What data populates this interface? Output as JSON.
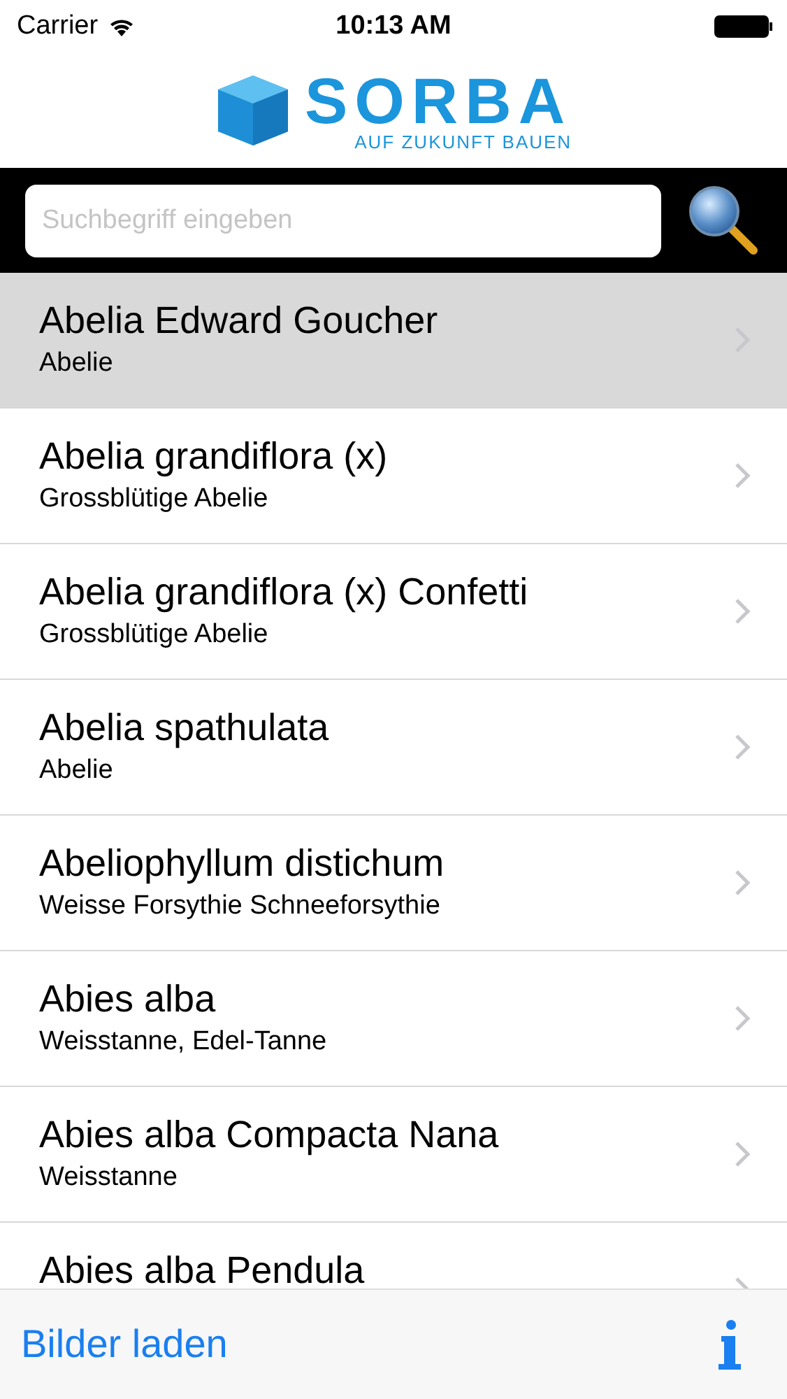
{
  "status_bar": {
    "carrier": "Carrier",
    "time": "10:13 AM"
  },
  "logo": {
    "name": "SORBA",
    "tagline": "AUF ZUKUNFT BAUEN"
  },
  "search": {
    "placeholder": "Suchbegriff eingeben"
  },
  "rows": [
    {
      "title": "Abelia  Edward Goucher",
      "subtitle": "Abelie",
      "selected": true
    },
    {
      "title": "Abelia grandiflora (x)",
      "subtitle": "Grossblütige Abelie",
      "selected": false
    },
    {
      "title": "Abelia grandiflora (x) Confetti",
      "subtitle": "Grossblütige Abelie",
      "selected": false
    },
    {
      "title": "Abelia spathulata",
      "subtitle": "Abelie",
      "selected": false
    },
    {
      "title": "Abeliophyllum distichum",
      "subtitle": "Weisse Forsythie Schneeforsythie",
      "selected": false
    },
    {
      "title": "Abies alba",
      "subtitle": "Weisstanne, Edel-Tanne",
      "selected": false
    },
    {
      "title": "Abies alba Compacta Nana",
      "subtitle": "Weisstanne",
      "selected": false
    },
    {
      "title": "Abies alba Pendula",
      "selected": false
    }
  ],
  "toolbar": {
    "load_button": "Bilder laden"
  }
}
